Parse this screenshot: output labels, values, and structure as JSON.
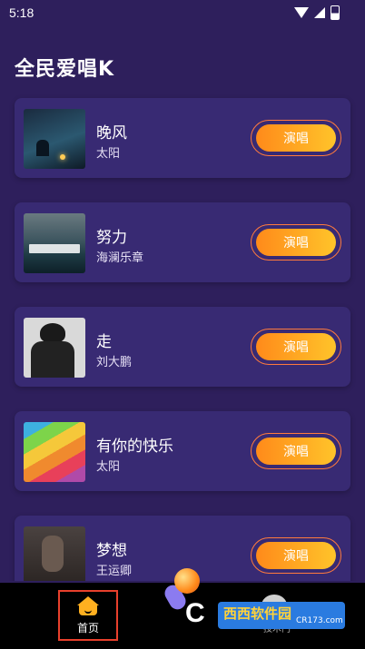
{
  "status_bar": {
    "time": "5:18"
  },
  "app": {
    "title": "全民爱唱K"
  },
  "songs": [
    {
      "name": "晚风",
      "artist": "太阳",
      "action": "演唱"
    },
    {
      "name": "努力",
      "artist": "海澜乐章",
      "action": "演唱"
    },
    {
      "name": "走",
      "artist": "刘大鹏",
      "action": "演唱"
    },
    {
      "name": "有你的快乐",
      "artist": "太阳",
      "action": "演唱"
    },
    {
      "name": "梦想",
      "artist": "王运卿",
      "action": "演唱"
    }
  ],
  "bottom_nav": {
    "home_label": "首页"
  },
  "watermark": {
    "logo": "C",
    "name": "西西软件园",
    "url": "CR173.com",
    "partial": "技术门"
  },
  "colors": {
    "background": "#2e1f5c",
    "card": "#382a73",
    "button_start": "#ff8a1a",
    "button_end": "#ffc42a",
    "nav_active_border": "#e8402c"
  }
}
